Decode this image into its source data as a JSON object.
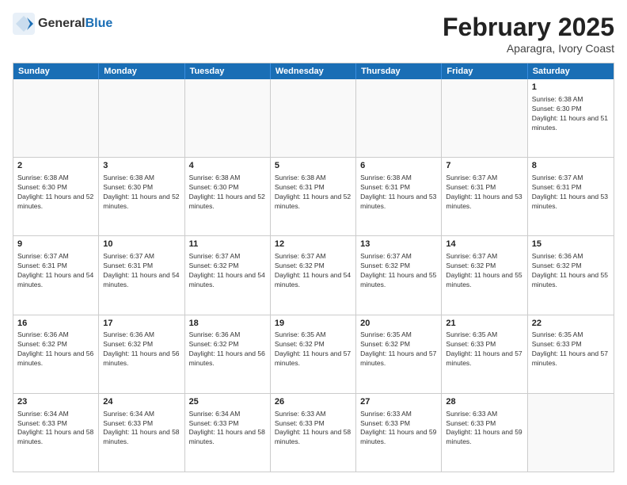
{
  "header": {
    "logo_general": "General",
    "logo_blue": "Blue",
    "month_title": "February 2025",
    "location": "Aparagra, Ivory Coast"
  },
  "weekdays": [
    "Sunday",
    "Monday",
    "Tuesday",
    "Wednesday",
    "Thursday",
    "Friday",
    "Saturday"
  ],
  "rows": [
    [
      {
        "day": "",
        "info": ""
      },
      {
        "day": "",
        "info": ""
      },
      {
        "day": "",
        "info": ""
      },
      {
        "day": "",
        "info": ""
      },
      {
        "day": "",
        "info": ""
      },
      {
        "day": "",
        "info": ""
      },
      {
        "day": "1",
        "info": "Sunrise: 6:38 AM\nSunset: 6:30 PM\nDaylight: 11 hours and 51 minutes."
      }
    ],
    [
      {
        "day": "2",
        "info": "Sunrise: 6:38 AM\nSunset: 6:30 PM\nDaylight: 11 hours and 52 minutes."
      },
      {
        "day": "3",
        "info": "Sunrise: 6:38 AM\nSunset: 6:30 PM\nDaylight: 11 hours and 52 minutes."
      },
      {
        "day": "4",
        "info": "Sunrise: 6:38 AM\nSunset: 6:30 PM\nDaylight: 11 hours and 52 minutes."
      },
      {
        "day": "5",
        "info": "Sunrise: 6:38 AM\nSunset: 6:31 PM\nDaylight: 11 hours and 52 minutes."
      },
      {
        "day": "6",
        "info": "Sunrise: 6:38 AM\nSunset: 6:31 PM\nDaylight: 11 hours and 53 minutes."
      },
      {
        "day": "7",
        "info": "Sunrise: 6:37 AM\nSunset: 6:31 PM\nDaylight: 11 hours and 53 minutes."
      },
      {
        "day": "8",
        "info": "Sunrise: 6:37 AM\nSunset: 6:31 PM\nDaylight: 11 hours and 53 minutes."
      }
    ],
    [
      {
        "day": "9",
        "info": "Sunrise: 6:37 AM\nSunset: 6:31 PM\nDaylight: 11 hours and 54 minutes."
      },
      {
        "day": "10",
        "info": "Sunrise: 6:37 AM\nSunset: 6:31 PM\nDaylight: 11 hours and 54 minutes."
      },
      {
        "day": "11",
        "info": "Sunrise: 6:37 AM\nSunset: 6:32 PM\nDaylight: 11 hours and 54 minutes."
      },
      {
        "day": "12",
        "info": "Sunrise: 6:37 AM\nSunset: 6:32 PM\nDaylight: 11 hours and 54 minutes."
      },
      {
        "day": "13",
        "info": "Sunrise: 6:37 AM\nSunset: 6:32 PM\nDaylight: 11 hours and 55 minutes."
      },
      {
        "day": "14",
        "info": "Sunrise: 6:37 AM\nSunset: 6:32 PM\nDaylight: 11 hours and 55 minutes."
      },
      {
        "day": "15",
        "info": "Sunrise: 6:36 AM\nSunset: 6:32 PM\nDaylight: 11 hours and 55 minutes."
      }
    ],
    [
      {
        "day": "16",
        "info": "Sunrise: 6:36 AM\nSunset: 6:32 PM\nDaylight: 11 hours and 56 minutes."
      },
      {
        "day": "17",
        "info": "Sunrise: 6:36 AM\nSunset: 6:32 PM\nDaylight: 11 hours and 56 minutes."
      },
      {
        "day": "18",
        "info": "Sunrise: 6:36 AM\nSunset: 6:32 PM\nDaylight: 11 hours and 56 minutes."
      },
      {
        "day": "19",
        "info": "Sunrise: 6:35 AM\nSunset: 6:32 PM\nDaylight: 11 hours and 57 minutes."
      },
      {
        "day": "20",
        "info": "Sunrise: 6:35 AM\nSunset: 6:32 PM\nDaylight: 11 hours and 57 minutes."
      },
      {
        "day": "21",
        "info": "Sunrise: 6:35 AM\nSunset: 6:33 PM\nDaylight: 11 hours and 57 minutes."
      },
      {
        "day": "22",
        "info": "Sunrise: 6:35 AM\nSunset: 6:33 PM\nDaylight: 11 hours and 57 minutes."
      }
    ],
    [
      {
        "day": "23",
        "info": "Sunrise: 6:34 AM\nSunset: 6:33 PM\nDaylight: 11 hours and 58 minutes."
      },
      {
        "day": "24",
        "info": "Sunrise: 6:34 AM\nSunset: 6:33 PM\nDaylight: 11 hours and 58 minutes."
      },
      {
        "day": "25",
        "info": "Sunrise: 6:34 AM\nSunset: 6:33 PM\nDaylight: 11 hours and 58 minutes."
      },
      {
        "day": "26",
        "info": "Sunrise: 6:33 AM\nSunset: 6:33 PM\nDaylight: 11 hours and 58 minutes."
      },
      {
        "day": "27",
        "info": "Sunrise: 6:33 AM\nSunset: 6:33 PM\nDaylight: 11 hours and 59 minutes."
      },
      {
        "day": "28",
        "info": "Sunrise: 6:33 AM\nSunset: 6:33 PM\nDaylight: 11 hours and 59 minutes."
      },
      {
        "day": "",
        "info": ""
      }
    ]
  ]
}
